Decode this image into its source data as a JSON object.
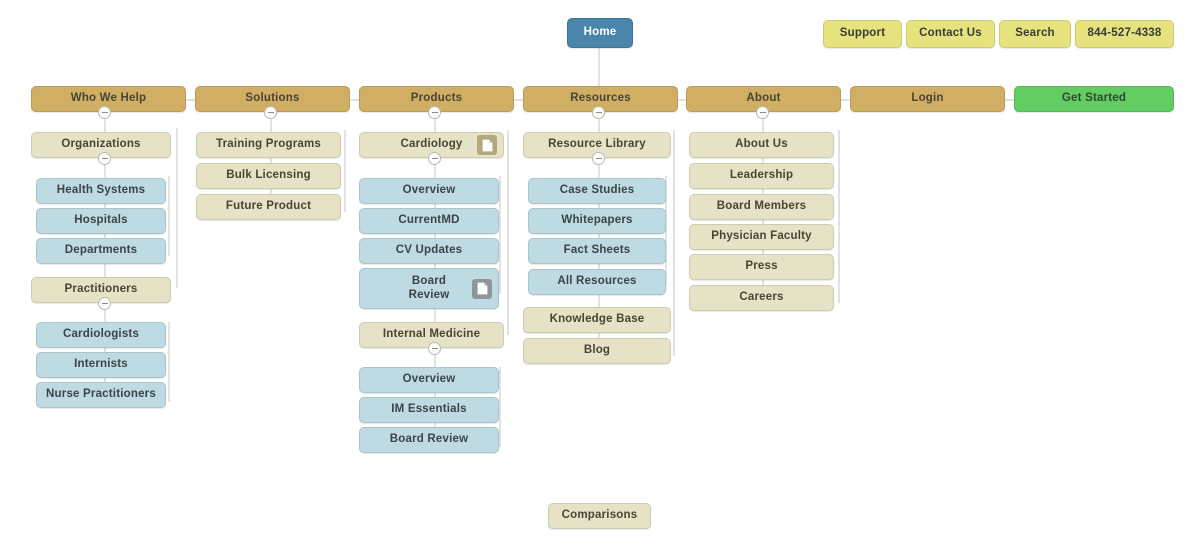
{
  "diagram": {
    "type": "sitemap",
    "title": "Website Sitemap",
    "colors": {
      "home": "#4a85ab",
      "utility": "#e6e37e",
      "nav": "#d0ae63",
      "cta_green": "#63cc63",
      "page_beige": "#e6e2c6",
      "page_blue": "#bedbe3",
      "connector": "#e2e2e0",
      "background": "#ffffff"
    }
  },
  "root": {
    "label": "Home"
  },
  "utility_nav": [
    {
      "label": "Support"
    },
    {
      "label": "Contact Us"
    },
    {
      "label": "Search"
    },
    {
      "label": "844-527-4338"
    }
  ],
  "main_nav": [
    {
      "label": "Who We Help",
      "has_children": true
    },
    {
      "label": "Solutions",
      "has_children": true
    },
    {
      "label": "Products",
      "has_children": true
    },
    {
      "label": "Resources",
      "has_children": true
    },
    {
      "label": "About",
      "has_children": true
    },
    {
      "label": "Login",
      "has_children": false
    },
    {
      "label": "Get Started",
      "has_children": false
    }
  ],
  "columns": {
    "who_we_help": [
      {
        "label": "Organizations",
        "has_children": true
      },
      {
        "label": "Health Systems"
      },
      {
        "label": "Hospitals"
      },
      {
        "label": "Departments"
      },
      {
        "label": "Practitioners",
        "has_children": true
      },
      {
        "label": "Cardiologists"
      },
      {
        "label": "Internists"
      },
      {
        "label": "Nurse Practitioners"
      }
    ],
    "solutions": [
      {
        "label": "Training Programs"
      },
      {
        "label": "Bulk Licensing"
      },
      {
        "label": "Future Product"
      }
    ],
    "products": [
      {
        "label": "Cardiology",
        "has_children": true,
        "icon": "document-icon"
      },
      {
        "label": "Overview"
      },
      {
        "label": "CurrentMD"
      },
      {
        "label": "CV Updates"
      },
      {
        "label": "Board Review",
        "icon": "document-icon"
      },
      {
        "label": "Internal Medicine",
        "has_children": true
      },
      {
        "label": "Overview"
      },
      {
        "label": "IM Essentials"
      },
      {
        "label": "Board Review"
      }
    ],
    "resources": [
      {
        "label": "Resource Library",
        "has_children": true
      },
      {
        "label": "Case Studies"
      },
      {
        "label": "Whitepapers"
      },
      {
        "label": "Fact Sheets"
      },
      {
        "label": "All Resources"
      },
      {
        "label": "Knowledge Base"
      },
      {
        "label": "Blog"
      }
    ],
    "about": [
      {
        "label": "About Us"
      },
      {
        "label": "Leadership"
      },
      {
        "label": "Board Members"
      },
      {
        "label": "Physician Faculty"
      },
      {
        "label": "Press"
      },
      {
        "label": "Careers"
      }
    ]
  },
  "orphan_nodes": [
    {
      "label": "Comparisons"
    }
  ],
  "product_board_review_line1": "Board",
  "product_board_review_line2": "Review"
}
